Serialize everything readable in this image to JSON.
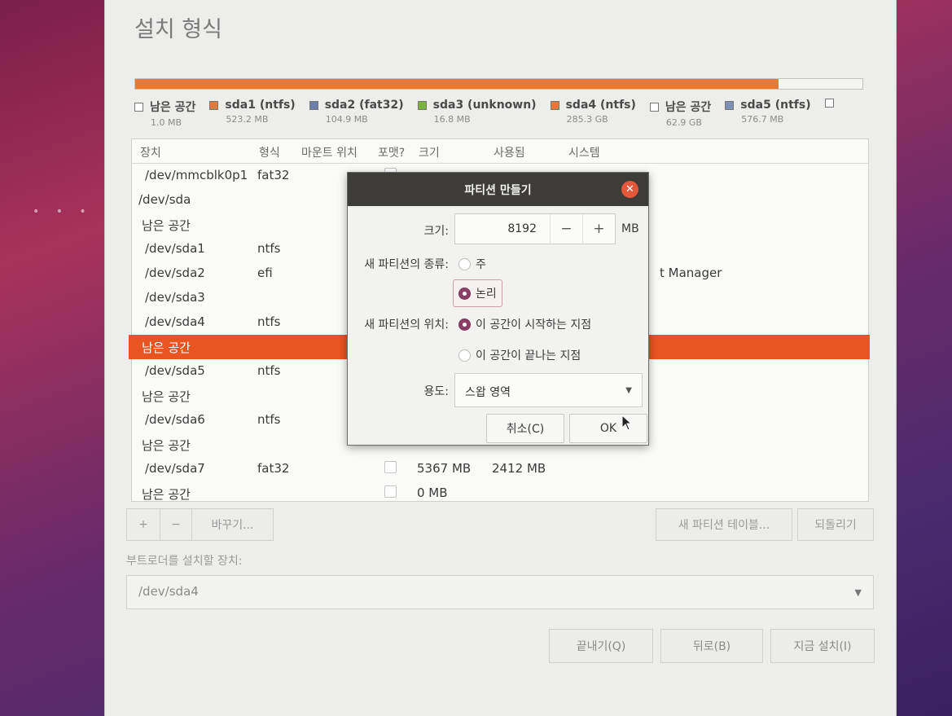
{
  "window": {
    "title": "설치 형식"
  },
  "usage_bar": {
    "fill_fraction": 0.885,
    "color": "#e07b3c"
  },
  "legend": [
    {
      "name": "남은 공간",
      "size": "1.0 MB",
      "color": "#ffffff"
    },
    {
      "name": "sda1 (ntfs)",
      "size": "523.2 MB",
      "color": "#e07b3c"
    },
    {
      "name": "sda2 (fat32)",
      "size": "104.9 MB",
      "color": "#6c7fa8"
    },
    {
      "name": "sda3 (unknown)",
      "size": "16.8 MB",
      "color": "#7bb33d"
    },
    {
      "name": "sda4 (ntfs)",
      "size": "285.3 GB",
      "color": "#e07b3c"
    },
    {
      "name": "남은 공간",
      "size": "62.9 GB",
      "color": "#ffffff"
    },
    {
      "name": "sda5 (ntfs)",
      "size": "576.7 MB",
      "color": "#7d8fb3"
    },
    {
      "name": "",
      "size": "",
      "color": "#ffffff"
    }
  ],
  "table": {
    "headers": [
      "장치",
      "형식",
      "마운트 위치",
      "포맷?",
      "크기",
      "사용됨",
      "시스템"
    ],
    "rows": [
      {
        "device": "/dev/mmcblk0p1",
        "type": "fat32",
        "mount": "",
        "size": "",
        "used": "",
        "system": "",
        "checkbox": true
      },
      {
        "device": "/dev/sda",
        "type": "",
        "mount": "",
        "size": "",
        "used": "",
        "system": ""
      },
      {
        "device": "남은 공간",
        "type": "",
        "mount": "",
        "size": "",
        "used": "",
        "system": ""
      },
      {
        "device": "/dev/sda1",
        "type": "ntfs",
        "mount": "",
        "size": "",
        "used": "",
        "system": ""
      },
      {
        "device": "/dev/sda2",
        "type": "efi",
        "mount": "",
        "size": "",
        "used": "",
        "system": "t Manager"
      },
      {
        "device": "/dev/sda3",
        "type": "",
        "mount": "",
        "size": "",
        "used": "",
        "system": ""
      },
      {
        "device": "/dev/sda4",
        "type": "ntfs",
        "mount": "",
        "size": "",
        "used": "",
        "system": ""
      },
      {
        "device": "남은 공간",
        "type": "",
        "mount": "",
        "size": "",
        "used": "",
        "system": "",
        "selected": true
      },
      {
        "device": "/dev/sda5",
        "type": "ntfs",
        "mount": "",
        "size": "",
        "used": "",
        "system": ""
      },
      {
        "device": "남은 공간",
        "type": "",
        "mount": "",
        "size": "",
        "used": "",
        "system": ""
      },
      {
        "device": "/dev/sda6",
        "type": "ntfs",
        "mount": "",
        "size": "",
        "used": "",
        "system": ""
      },
      {
        "device": "남은 공간",
        "type": "",
        "mount": "",
        "size": "",
        "used": "",
        "system": ""
      },
      {
        "device": "/dev/sda7",
        "type": "fat32",
        "mount": "",
        "size": "5367 MB",
        "used": "2412 MB",
        "system": "",
        "checkbox": true
      },
      {
        "device": "남은 공간",
        "type": "",
        "mount": "",
        "size": "0 MB",
        "used": "",
        "system": "",
        "checkbox": true
      }
    ]
  },
  "toolbar": {
    "add_label": "+",
    "remove_label": "−",
    "change_label": "바꾸기...",
    "new_table_label": "새 파티션 테이블...",
    "revert_label": "되돌리기"
  },
  "bootloader": {
    "label": "부트로더를 설치할 장치:",
    "value": "/dev/sda4"
  },
  "bottom_buttons": {
    "quit": "끝내기(Q)",
    "back": "뒤로(B)",
    "install": "지금 설치(I)"
  },
  "dialog": {
    "title": "파티션 만들기",
    "size_label": "크기:",
    "size_value": "8192",
    "size_unit": "MB",
    "type_label": "새 파티션의 종류:",
    "type_primary": "주",
    "type_logical": "논리",
    "type_selected": "logical",
    "location_label": "새 파티션의 위치:",
    "location_begin": "이 공간이 시작하는 지점",
    "location_end": "이 공간이 끝나는 지점",
    "location_selected": "begin",
    "use_label": "용도:",
    "use_value": "스왑 영역",
    "cancel": "취소(C)",
    "ok": "OK"
  }
}
